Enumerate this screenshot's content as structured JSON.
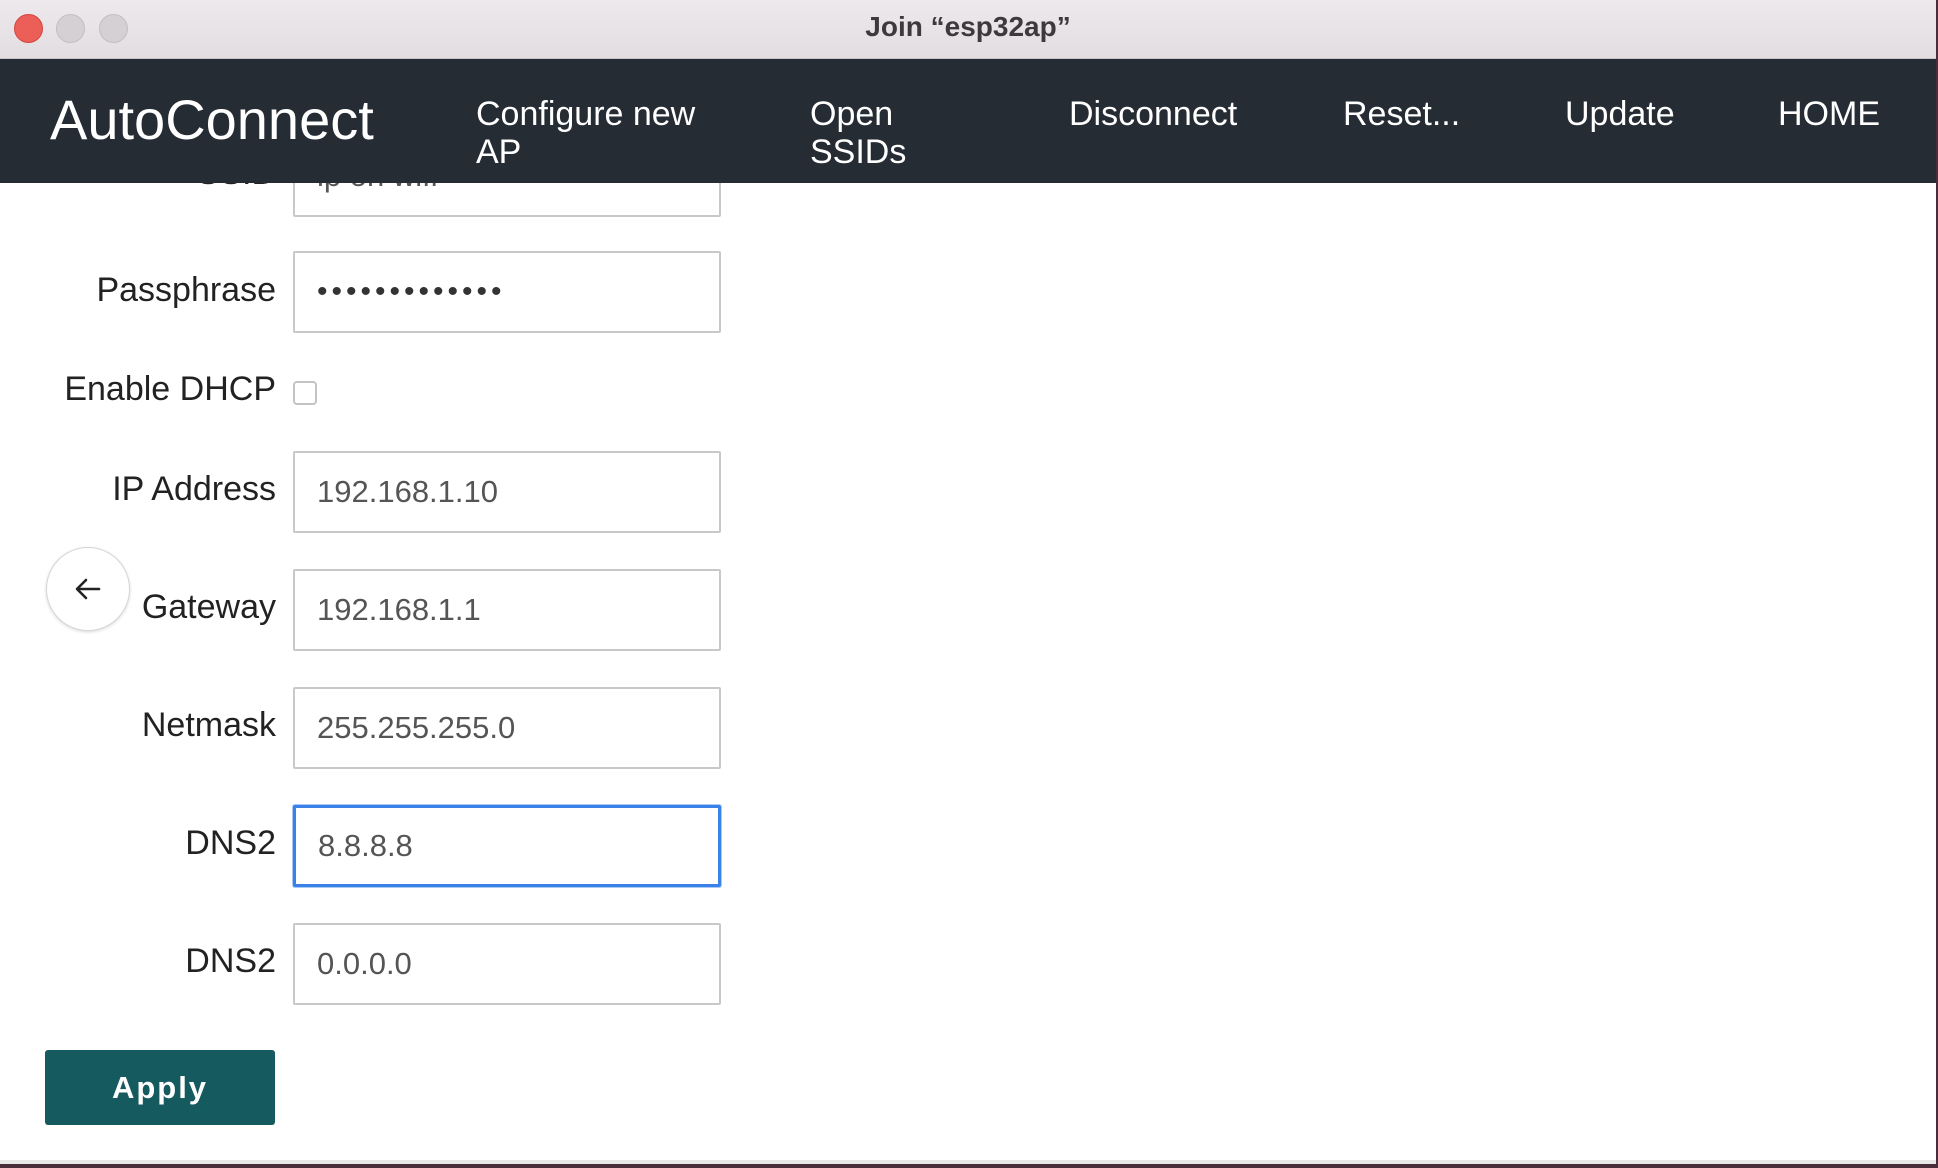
{
  "window": {
    "title": "Join “esp32ap”"
  },
  "navbar": {
    "brand": "AutoConnect",
    "items": [
      {
        "label_line1": "Configure new",
        "label_line2": "AP"
      },
      {
        "label_line1": "Open",
        "label_line2": "SSIDs"
      },
      {
        "label_line1": "Disconnect",
        "label_line2": ""
      },
      {
        "label_line1": "Reset...",
        "label_line2": ""
      },
      {
        "label_line1": "Update",
        "label_line2": ""
      },
      {
        "label_line1": "HOME",
        "label_line2": ""
      }
    ]
  },
  "form": {
    "ssid": {
      "label": "SSID",
      "value": "ip on wifi"
    },
    "passphrase": {
      "label": "Passphrase",
      "value": "•••••••••••••"
    },
    "dhcp": {
      "label": "Enable DHCP",
      "checked": false
    },
    "ip_address": {
      "label": "IP Address",
      "value": "192.168.1.10"
    },
    "gateway": {
      "label": "Gateway",
      "value": "192.168.1.1"
    },
    "netmask": {
      "label": "Netmask",
      "value": "255.255.255.0"
    },
    "dns1": {
      "label": "DNS2",
      "value": "8.8.8.8"
    },
    "dns2": {
      "label": "DNS2",
      "value": "0.0.0.0"
    },
    "apply_label": "Apply"
  },
  "icons": {
    "back": "arrow-left-icon"
  },
  "colors": {
    "navbar_bg": "#252c34",
    "apply_bg": "#145a5e",
    "focus_border": "#3b82e8"
  }
}
